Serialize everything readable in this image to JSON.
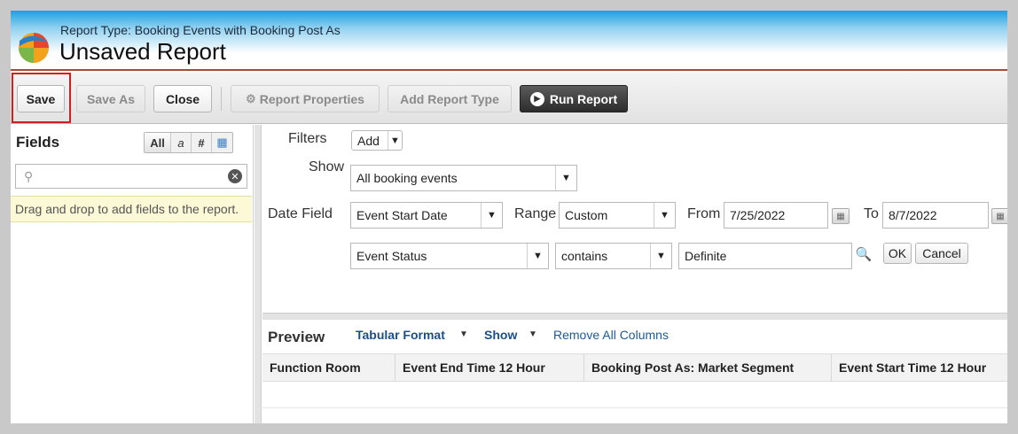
{
  "header": {
    "report_type": "Report Type: Booking Events with Booking Post As",
    "title": "Unsaved Report"
  },
  "toolbar": {
    "save_label": "Save",
    "save_as_label": "Save As",
    "close_label": "Close",
    "report_properties_label": "Report Properties",
    "add_report_type_label": "Add Report Type",
    "run_report_label": "Run Report",
    "highlight_color": "#d21e1e"
  },
  "fields_panel": {
    "title": "Fields",
    "filter_buttons": [
      "All",
      "a",
      "#",
      "▦"
    ],
    "search_value": "",
    "hint": "Drag and drop to add fields to the report."
  },
  "filters": {
    "filters_label": "Filters",
    "add_label": "Add",
    "show_label": "Show",
    "show_value": "All booking events",
    "date_field_label": "Date Field",
    "date_field_value": "Event Start Date",
    "range_label": "Range",
    "range_value": "Custom",
    "from_label": "From",
    "from_value": "7/25/2022",
    "to_label": "To",
    "to_value": "8/7/2022",
    "criteria": {
      "field": "Event Status",
      "operator": "contains",
      "value": "Definite",
      "ok_label": "OK",
      "cancel_label": "Cancel"
    }
  },
  "preview": {
    "title": "Preview",
    "format_label": "Tabular Format",
    "show_label": "Show",
    "remove_columns_label": "Remove All Columns",
    "columns": [
      "Function Room",
      "Event End Time 12 Hour",
      "Booking Post As: Market Segment",
      "Event Start Time 12 Hour"
    ]
  }
}
